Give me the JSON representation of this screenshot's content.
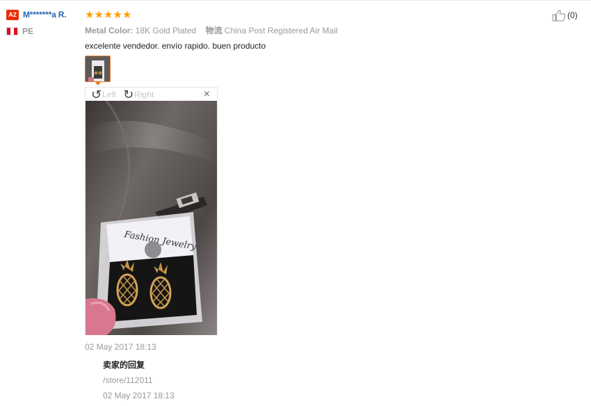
{
  "buyer": {
    "level_badge": "A2",
    "name": "M*******a R.",
    "country": "PE"
  },
  "review": {
    "rating": 5,
    "star_glyph": "★",
    "attributes": [
      {
        "key": "Metal Color:",
        "value": "18K Gold Plated"
      },
      {
        "key": "物流",
        "value": "China Post Registered Air Mail"
      }
    ],
    "text": "excelente vendedor. envío rapido. buen producto",
    "date": "02 May 2017 18:13"
  },
  "viewer": {
    "rotate_left_label": "Left",
    "rotate_right_label": "Right",
    "close_glyph": "×",
    "card_text": "Fashion Jewelry"
  },
  "reply": {
    "title": "卖家的回复",
    "link": "/store/112011",
    "date": "02 May 2017 18:13"
  },
  "helpful": {
    "count_label": "(0)"
  },
  "colors": {
    "star": "#ff9d00",
    "name": "#2568b8",
    "badge": "#e62e04",
    "thumb_border": "#e57b27"
  }
}
